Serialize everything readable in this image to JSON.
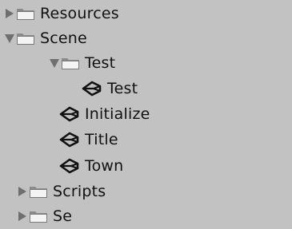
{
  "tree": {
    "items": [
      {
        "label": "Resources",
        "icon": "folder-icon",
        "expanded": false
      },
      {
        "label": "Scene",
        "icon": "folder-icon",
        "expanded": true
      },
      {
        "label": "Test",
        "icon": "folder-icon",
        "expanded": true
      },
      {
        "label": "Test",
        "icon": "unity-scene-icon"
      },
      {
        "label": "Initialize",
        "icon": "unity-scene-icon"
      },
      {
        "label": "Title",
        "icon": "unity-scene-icon"
      },
      {
        "label": "Town",
        "icon": "unity-scene-icon"
      },
      {
        "label": "Scripts",
        "icon": "folder-icon",
        "expanded": false
      },
      {
        "label": "Se",
        "icon": "folder-icon",
        "expanded": false
      }
    ]
  }
}
